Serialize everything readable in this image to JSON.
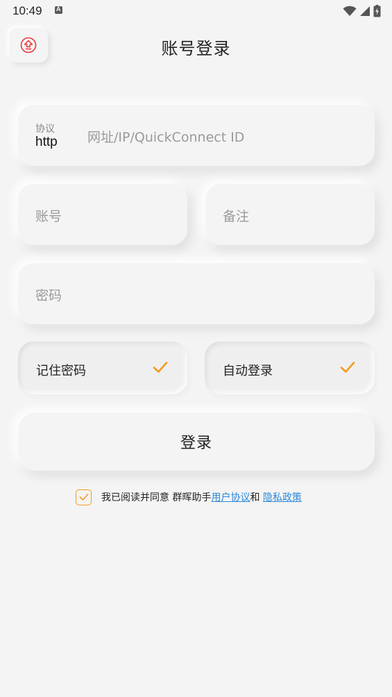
{
  "status_bar": {
    "time": "10:49"
  },
  "header": {
    "title": "账号登录"
  },
  "form": {
    "protocol_label": "协议",
    "protocol_value": "http",
    "address_placeholder": "网址/IP/QuickConnect ID",
    "account_placeholder": "账号",
    "note_placeholder": "备注",
    "password_placeholder": "密码"
  },
  "options": {
    "remember_password_label": "记住密码",
    "auto_login_label": "自动登录",
    "remember_password_checked": true,
    "auto_login_checked": true
  },
  "login_button_label": "登录",
  "agreement": {
    "prefix": "我已阅读并同意 群晖助手",
    "user_agreement": "用户协议",
    "and": "和",
    "privacy_policy": "隐私政策",
    "checked": true
  },
  "colors": {
    "accent_orange": "#f39a1e",
    "link_blue": "#2b88d8",
    "back_icon_red": "#e8373a",
    "background": "#f4f4f4"
  },
  "icons": {
    "back": "home-upload-icon",
    "check": "checkmark-icon",
    "wifi": "wifi-icon",
    "signal": "signal-icon",
    "battery": "battery-icon"
  }
}
